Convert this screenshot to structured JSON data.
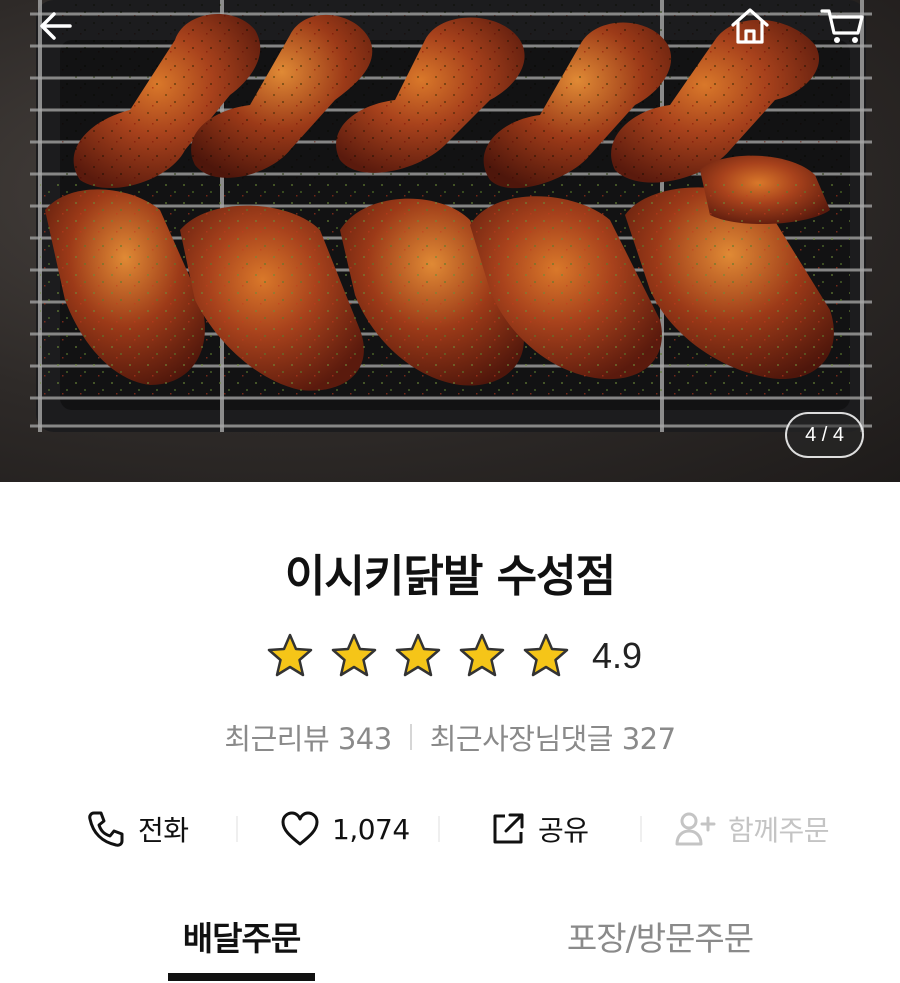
{
  "header": {
    "back_icon": "arrow-left-icon",
    "home_icon": "home-icon",
    "cart_icon": "cart-icon"
  },
  "gallery": {
    "counter": "4 / 4"
  },
  "store": {
    "name": "이시키닭발 수성점",
    "rating": "4.9",
    "stars_filled": 5,
    "stars_total": 5,
    "star_color": "#f5c518",
    "recent_reviews": "최근리뷰 343",
    "owner_replies": "최근사장님댓글 327"
  },
  "actions": [
    {
      "icon": "phone-icon",
      "label": "전화"
    },
    {
      "icon": "heart-icon",
      "label": "1,074"
    },
    {
      "icon": "share-icon",
      "label": "공유"
    },
    {
      "icon": "add-person-icon",
      "label": "함께주문"
    }
  ],
  "tabs": [
    {
      "label": "배달주문",
      "active": true
    },
    {
      "label": "포장/방문주문",
      "active": false
    }
  ]
}
